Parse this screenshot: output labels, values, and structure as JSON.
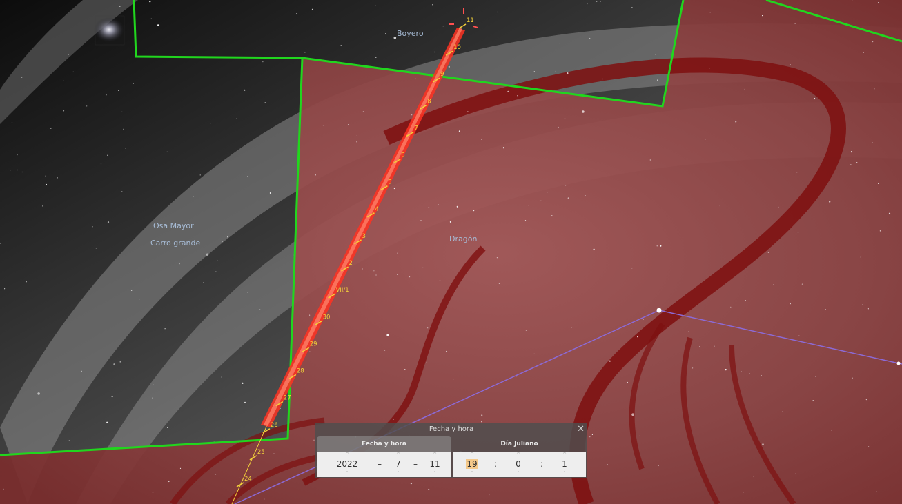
{
  "constellations": {
    "bootes": "Boyero",
    "ursa_major": "Osa Mayor",
    "big_dipper": "Carro grande",
    "draco": "Dragón"
  },
  "path_ticks": [
    "24",
    "25",
    "26",
    "27",
    "28",
    "29",
    "30",
    "VII/1",
    "2",
    "3",
    "4",
    "5",
    "6",
    "7",
    "8",
    "9",
    "10",
    "11"
  ],
  "colors": {
    "boundary": "#21d61e",
    "selected_region": "#8b1a1a",
    "trajectory": "#ff3322",
    "tick": "#f4d23a",
    "asterism_line": "#8c6ad6"
  },
  "dialog": {
    "title": "Fecha y hora",
    "close": "✕",
    "tab_datetime": "Fecha y hora",
    "tab_julian": "Día Juliano",
    "up_arrow": "^",
    "down_arrow": "ˇ",
    "date": {
      "year": "2022",
      "month": "7",
      "day": "11",
      "sep": "–"
    },
    "time": {
      "hour": "19",
      "minute": "0",
      "second": "1",
      "sep": ":"
    }
  }
}
